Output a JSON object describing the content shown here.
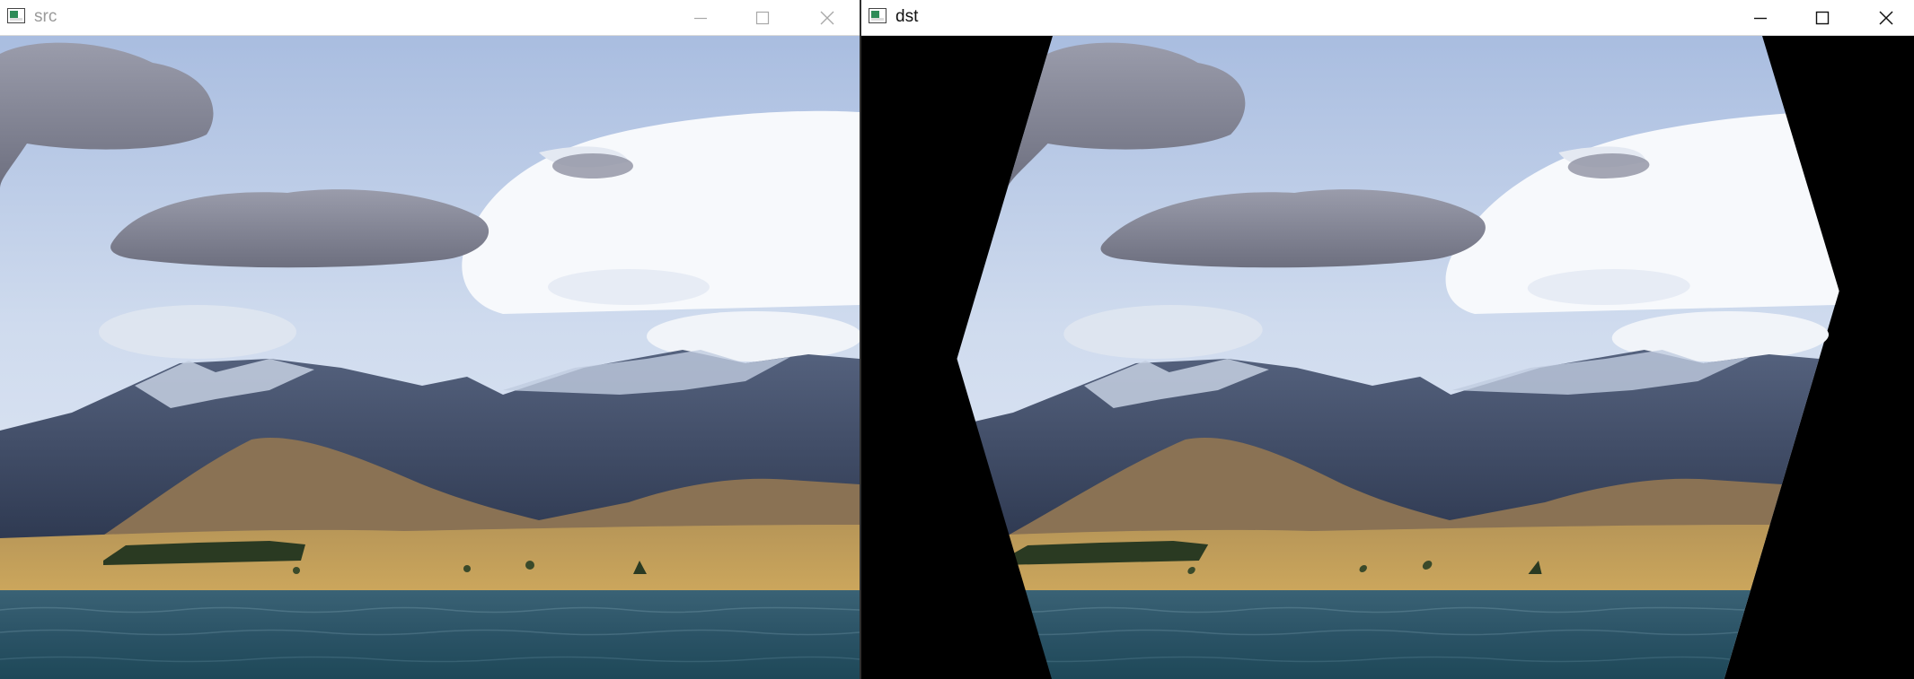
{
  "windows": {
    "src": {
      "title": "src"
    },
    "dst": {
      "title": "dst"
    }
  },
  "controls": {
    "minimize": "minimize-icon",
    "maximize": "maximize-icon",
    "close": "close-icon"
  },
  "colors": {
    "sky_top": "#9fb6d9",
    "sky_mid": "#d5dff0",
    "cloud_white": "#f6f8fb",
    "cloud_grey": "#7d7f8e",
    "mountain": "#3d4a66",
    "snow": "#cdd7e8",
    "hill": "#8c7355",
    "field": "#c4a15c",
    "trees": "#2c3b22",
    "water": "#2d5468",
    "water_deep": "#1f4152",
    "warp_fill": "#000000"
  }
}
